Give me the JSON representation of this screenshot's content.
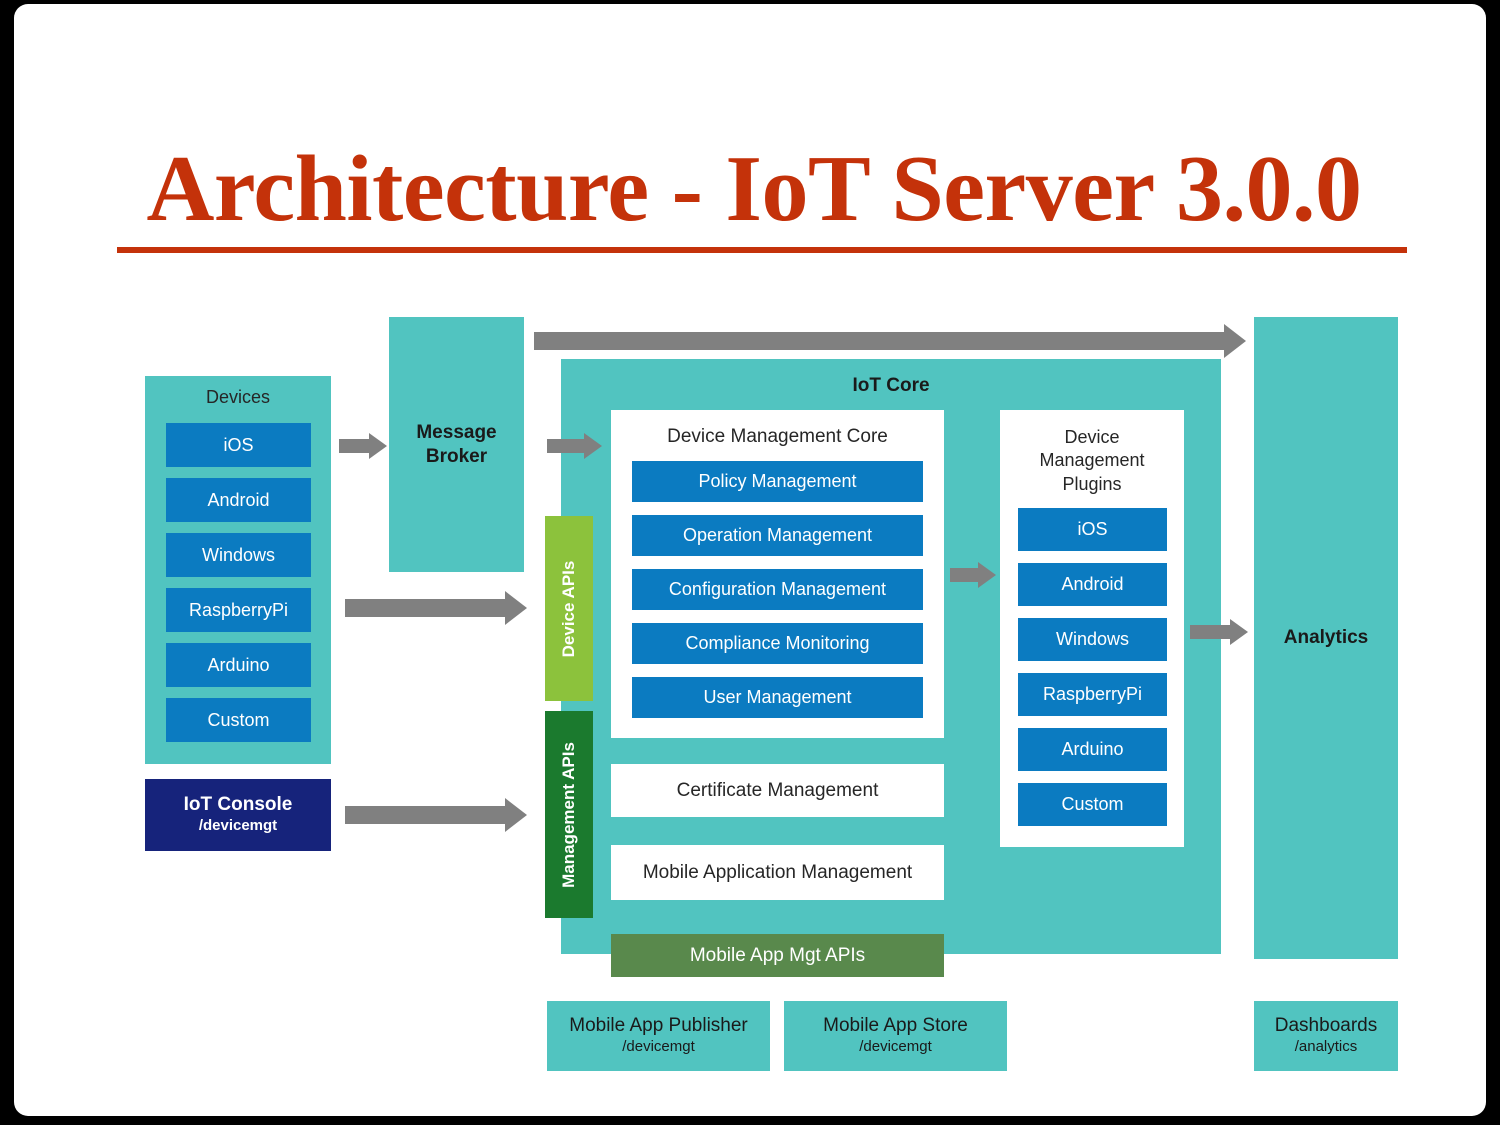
{
  "slide": {
    "title": "Architecture - IoT Server 3.0.0",
    "title_color": "#C4320A"
  },
  "palette": {
    "teal": "#51C4C0",
    "blue": "#0B7BC1",
    "navy": "#16237B",
    "light_green": "#8CC23C",
    "dark_green": "#1B7A2E",
    "mid_green": "#59894C",
    "arrow_gray": "#808080",
    "panel_white": "#FFFFFF"
  },
  "devices": {
    "title": "Devices",
    "items": [
      {
        "label": "iOS"
      },
      {
        "label": "Android"
      },
      {
        "label": "Windows"
      },
      {
        "label": "RaspberryPi"
      },
      {
        "label": "Arduino"
      },
      {
        "label": "Custom"
      }
    ]
  },
  "iot_console": {
    "name": "IoT Console",
    "path": "/devicemgt"
  },
  "message_broker": {
    "line1": "Message",
    "line2": "Broker"
  },
  "apis": {
    "device_apis": "Device APIs",
    "management_apis": "Management APIs",
    "mobile_app_mgt_apis": "Mobile App Mgt APIs"
  },
  "iot_core": {
    "title": "IoT Core",
    "device_management_core": {
      "title": "Device Management Core",
      "items": [
        {
          "label": "Policy Management"
        },
        {
          "label": "Operation Management"
        },
        {
          "label": "Configuration Management"
        },
        {
          "label": "Compliance Monitoring"
        },
        {
          "label": "User Management"
        }
      ]
    },
    "device_management_plugins": {
      "title": "Device\nManagement\nPlugins",
      "title_line1": "Device",
      "title_line2": "Management",
      "title_line3": "Plugins",
      "items": [
        {
          "label": "iOS"
        },
        {
          "label": "Android"
        },
        {
          "label": "Windows"
        },
        {
          "label": "RaspberryPi"
        },
        {
          "label": "Arduino"
        },
        {
          "label": "Custom"
        }
      ]
    },
    "certificate_management": "Certificate Management",
    "mobile_application_management": "Mobile Application Management"
  },
  "analytics": {
    "label": "Analytics"
  },
  "bottom": {
    "mobile_app_publisher": {
      "name": "Mobile App Publisher",
      "path": "/devicemgt"
    },
    "mobile_app_store": {
      "name": "Mobile App Store",
      "path": "/devicemgt"
    },
    "dashboards": {
      "name": "Dashboards",
      "path": "/analytics"
    }
  },
  "arrows": [
    {
      "name": "devices-to-message-broker"
    },
    {
      "name": "message-broker-to-iot-core"
    },
    {
      "name": "devices-to-device-apis"
    },
    {
      "name": "iot-console-to-management-apis"
    },
    {
      "name": "core-to-plugins"
    },
    {
      "name": "plugins-to-analytics"
    },
    {
      "name": "message-broker-to-analytics"
    }
  ]
}
